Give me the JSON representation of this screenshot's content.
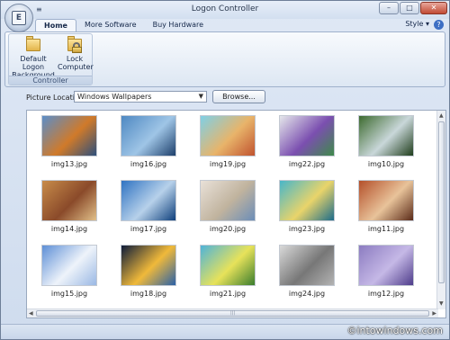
{
  "window": {
    "title": "Logon Controller"
  },
  "qat": {
    "glyph": "≡"
  },
  "app_orb": {
    "glyph": "E"
  },
  "window_controls": {
    "minimize": "–",
    "maximize": "□",
    "close": "✕"
  },
  "tabs": [
    {
      "label": "Home",
      "active": true
    },
    {
      "label": "More Software",
      "active": false
    },
    {
      "label": "Buy Hardware",
      "active": false
    }
  ],
  "style_menu": {
    "label": "Style ▾",
    "help": "?"
  },
  "ribbon": {
    "group_label": "Controller",
    "buttons": [
      {
        "line1": "Default Logon",
        "line2": "Background",
        "icon": "folder-icon"
      },
      {
        "line1": "Lock",
        "line2": "Computer",
        "icon": "lock-icon"
      }
    ]
  },
  "picture_location": {
    "label": "Picture Location:",
    "selected": "Windows Wallpapers",
    "dropdown_arrow": "▼",
    "browse_label": "Browse..."
  },
  "gallery": {
    "images": [
      {
        "name": "img13.jpg",
        "colors": [
          "#5b8ec9",
          "#d07a2a",
          "#2d4f7c"
        ]
      },
      {
        "name": "img16.jpg",
        "colors": [
          "#4e88c2",
          "#9fc5e6",
          "#1d3f6b"
        ]
      },
      {
        "name": "img19.jpg",
        "colors": [
          "#7fd0e6",
          "#e8b46a",
          "#c0532f"
        ]
      },
      {
        "name": "img22.jpg",
        "colors": [
          "#e5e7ea",
          "#7b4fb0",
          "#3e8a4a"
        ]
      },
      {
        "name": "img10.jpg",
        "colors": [
          "#3d6b2f",
          "#c9d7d9",
          "#1f3d1c"
        ]
      },
      {
        "name": "img14.jpg",
        "colors": [
          "#c88c4a",
          "#8a4a2a",
          "#e1c08a"
        ]
      },
      {
        "name": "img17.jpg",
        "colors": [
          "#2f73c2",
          "#b7d1ea",
          "#0e3f7c"
        ]
      },
      {
        "name": "img20.jpg",
        "colors": [
          "#e9e1d8",
          "#c0b39e",
          "#6b8db8"
        ]
      },
      {
        "name": "img23.jpg",
        "colors": [
          "#48b6c9",
          "#e9d46a",
          "#1c6c8a"
        ]
      },
      {
        "name": "img11.jpg",
        "colors": [
          "#b4502a",
          "#e8c39a",
          "#5a2a18"
        ]
      },
      {
        "name": "img15.jpg",
        "colors": [
          "#5d8fd6",
          "#eef3fa",
          "#9ab8e4"
        ]
      },
      {
        "name": "img18.jpg",
        "colors": [
          "#0d1b3a",
          "#f0b93a",
          "#2a61a8"
        ]
      },
      {
        "name": "img21.jpg",
        "colors": [
          "#4fb3d9",
          "#e7e25a",
          "#3a7d2e"
        ]
      },
      {
        "name": "img24.jpg",
        "colors": [
          "#d9d9d9",
          "#777777",
          "#b3b3b3"
        ]
      },
      {
        "name": "img12.jpg",
        "colors": [
          "#8c7cc1",
          "#c5b8e6",
          "#4e3c8a"
        ]
      }
    ]
  },
  "scrollbar": {
    "up": "▲",
    "down": "▼",
    "left": "◀",
    "right": "▶",
    "grip": "|||"
  },
  "watermark": "©intowindows.com"
}
